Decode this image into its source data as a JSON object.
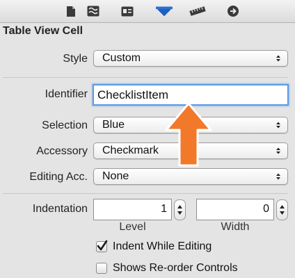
{
  "toolbar": {
    "icons": [
      "file-inspector-icon",
      "quick-help-icon",
      "identity-inspector-icon",
      "attributes-inspector-icon",
      "size-inspector-icon",
      "connections-inspector-icon"
    ]
  },
  "section": {
    "title": "Table View Cell"
  },
  "style": {
    "label": "Style",
    "value": "Custom"
  },
  "identifier": {
    "label": "Identifier",
    "value": "ChecklistItem"
  },
  "selection": {
    "label": "Selection",
    "value": "Blue"
  },
  "accessory": {
    "label": "Accessory",
    "value": "Checkmark"
  },
  "editing_accessory": {
    "label": "Editing Acc.",
    "value": "None"
  },
  "indentation": {
    "label": "Indentation",
    "level": {
      "value": "1",
      "caption": "Level"
    },
    "width": {
      "value": "0",
      "caption": "Width"
    }
  },
  "indent_while_editing": {
    "label": "Indent While Editing",
    "checked": true
  },
  "shows_reorder_controls": {
    "label": "Shows Re-order Controls",
    "checked": false
  },
  "colors": {
    "focus_ring": "#5b9ae6",
    "callout_arrow": "#f2782a",
    "callout_border": "#ffffff"
  }
}
